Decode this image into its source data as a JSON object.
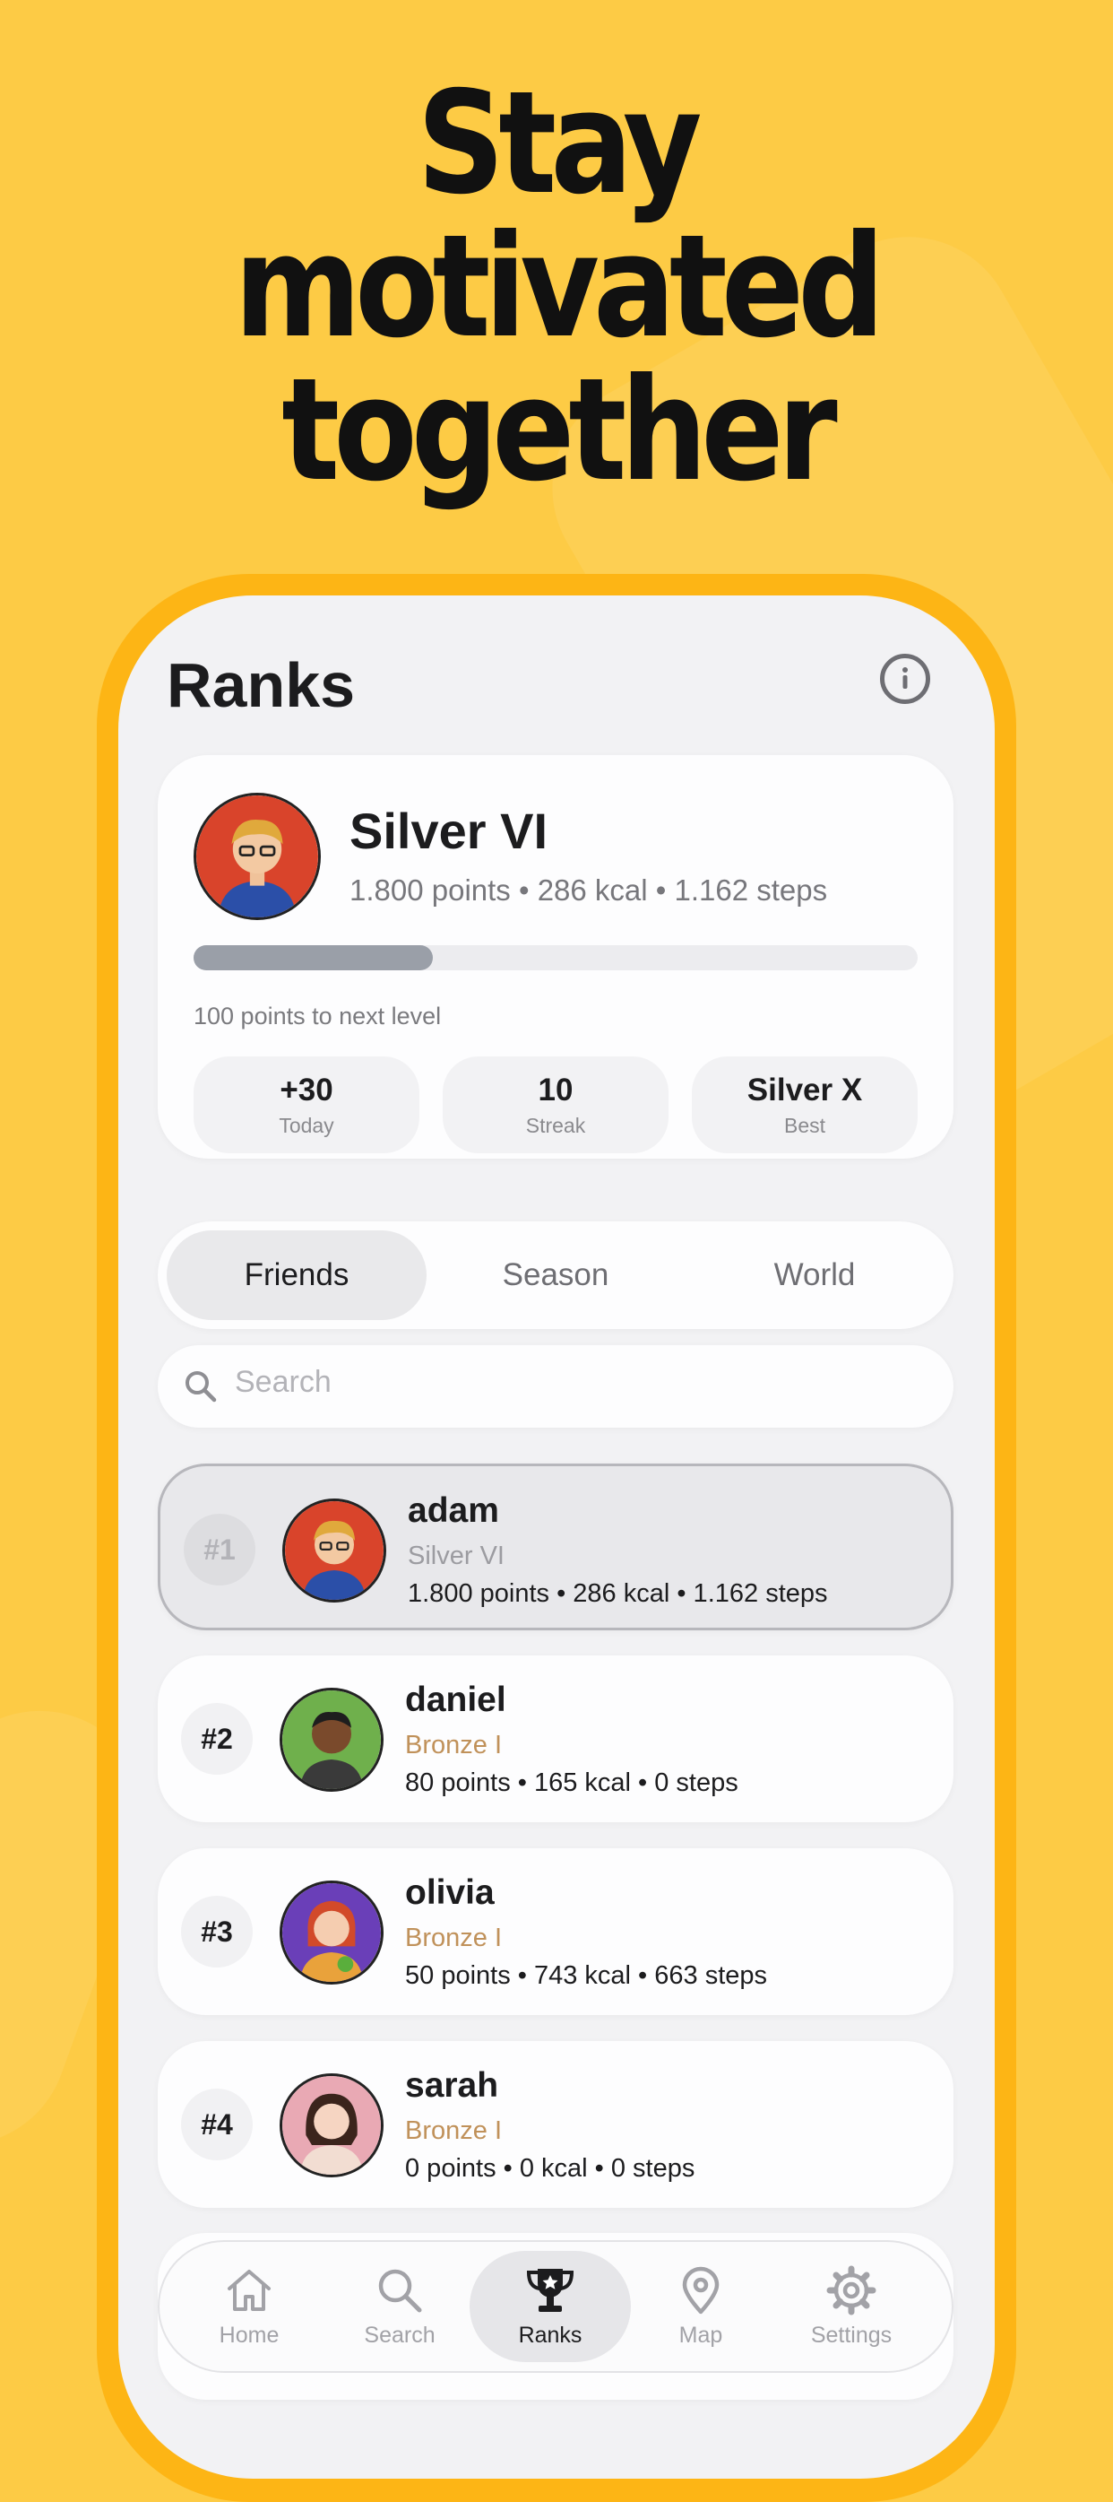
{
  "headline": [
    "Stay",
    "motivated",
    "together"
  ],
  "screen": {
    "title": "Ranks",
    "info_icon": "info-circle-icon"
  },
  "profile": {
    "tier": "Silver VI",
    "stats": "1.800 points • 286 kcal • 1.162 steps",
    "progress": 0.33,
    "next_level": "100 points to next level",
    "boxes": [
      {
        "value": "+30",
        "label": "Today"
      },
      {
        "value": "10",
        "label": "Streak"
      },
      {
        "value": "Silver X",
        "label": "Best"
      }
    ]
  },
  "segments": {
    "items": [
      "Friends",
      "Season",
      "World"
    ],
    "active": "Friends"
  },
  "search": {
    "placeholder": "Search"
  },
  "leaderboard": [
    {
      "rank": "#1",
      "name": "adam",
      "tier": "Silver VI",
      "stats": "1.800 points • 286 kcal • 1.162 steps",
      "is_me": true
    },
    {
      "rank": "#2",
      "name": "daniel",
      "tier": "Bronze I",
      "stats": "80 points • 165 kcal • 0 steps",
      "is_me": false
    },
    {
      "rank": "#3",
      "name": "olivia",
      "tier": "Bronze I",
      "stats": "50 points • 743 kcal • 663 steps",
      "is_me": false
    },
    {
      "rank": "#4",
      "name": "sarah",
      "tier": "Bronze I",
      "stats": "0 points • 0 kcal • 0 steps",
      "is_me": false
    }
  ],
  "tabbar": [
    {
      "label": "Home",
      "icon": "home-icon"
    },
    {
      "label": "Search",
      "icon": "search-icon"
    },
    {
      "label": "Ranks",
      "icon": "trophy-icon",
      "active": true
    },
    {
      "label": "Map",
      "icon": "map-pin-icon"
    },
    {
      "label": "Settings",
      "icon": "gear-icon"
    }
  ],
  "colors": {
    "background": "#FDCB45",
    "phone_frame": "#FDB515",
    "bronze": "#C0915A",
    "text_primary": "#1C1C1E"
  }
}
